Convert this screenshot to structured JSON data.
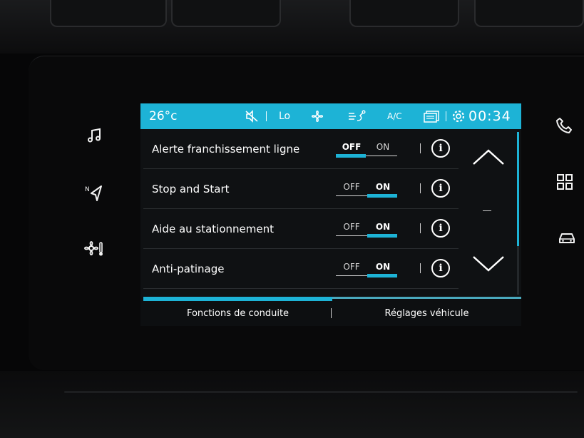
{
  "status_bar": {
    "temperature": "26°c",
    "fan_level": "Lo",
    "ac_label": "A/C",
    "clock": "00:34",
    "icons": [
      "mute-icon",
      "fan-icon",
      "air-distribution-icon",
      "screen-icon",
      "settings-icon"
    ],
    "background_color": "#1db3d6"
  },
  "settings": {
    "rows": [
      {
        "label": "Alerte franchissement ligne",
        "off": "OFF",
        "on": "ON",
        "state": "off"
      },
      {
        "label": "Stop and Start",
        "off": "OFF",
        "on": "ON",
        "state": "on"
      },
      {
        "label": "Aide au stationnement",
        "off": "OFF",
        "on": "ON",
        "state": "on"
      },
      {
        "label": "Anti-patinage",
        "off": "OFF",
        "on": "ON",
        "state": "on"
      }
    ]
  },
  "tabs": [
    {
      "label": "Fonctions de conduite",
      "active": true
    },
    {
      "label": "Réglages véhicule",
      "active": false
    }
  ],
  "side_buttons": {
    "left": [
      "music-icon",
      "navigation-icon",
      "climate-icon"
    ],
    "right": [
      "phone-icon",
      "apps-icon",
      "car-icon"
    ]
  },
  "accent_color": "#1db3d6"
}
